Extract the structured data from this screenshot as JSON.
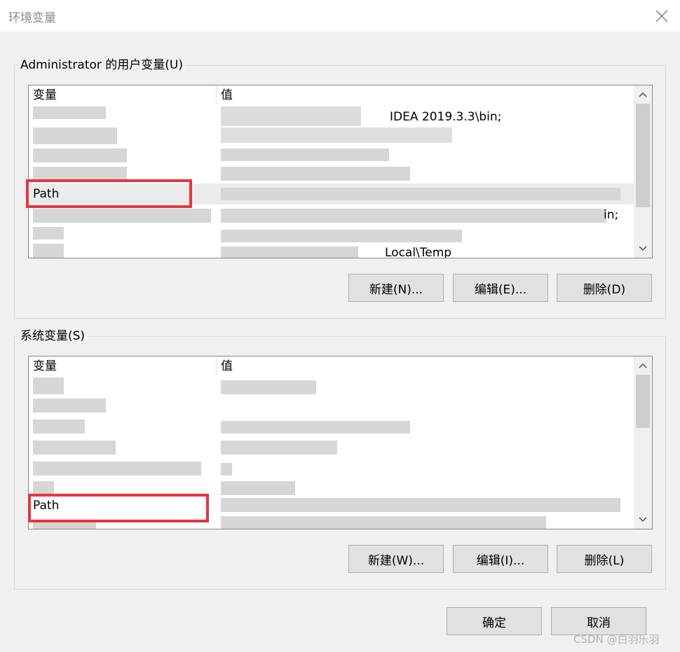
{
  "window": {
    "title": "环境变量",
    "close_icon": "close-icon"
  },
  "user_vars": {
    "legend": "Administrator 的用户变量(U)",
    "col_name": "变量",
    "col_value": "值",
    "value_fragment_1": "IDEA 2019.3.3\\bin;",
    "path_name": "Path",
    "value_fragment_2": "in;",
    "value_fragment_3": "Local\\Temp",
    "buttons": {
      "new": "新建(N)...",
      "edit": "编辑(E)...",
      "delete": "删除(D)"
    }
  },
  "system_vars": {
    "legend": "系统变量(S)",
    "col_name": "变量",
    "col_value": "值",
    "path_name": "Path",
    "buttons": {
      "new": "新建(W)...",
      "edit": "编辑(I)...",
      "delete": "删除(L)"
    }
  },
  "footer": {
    "ok": "确定",
    "cancel": "取消"
  },
  "watermark": "CSDN @白羽乐羽",
  "colors": {
    "highlight": "#e8353b",
    "window_bg": "#f0f0f0",
    "button_bg": "#e1e1e1"
  }
}
